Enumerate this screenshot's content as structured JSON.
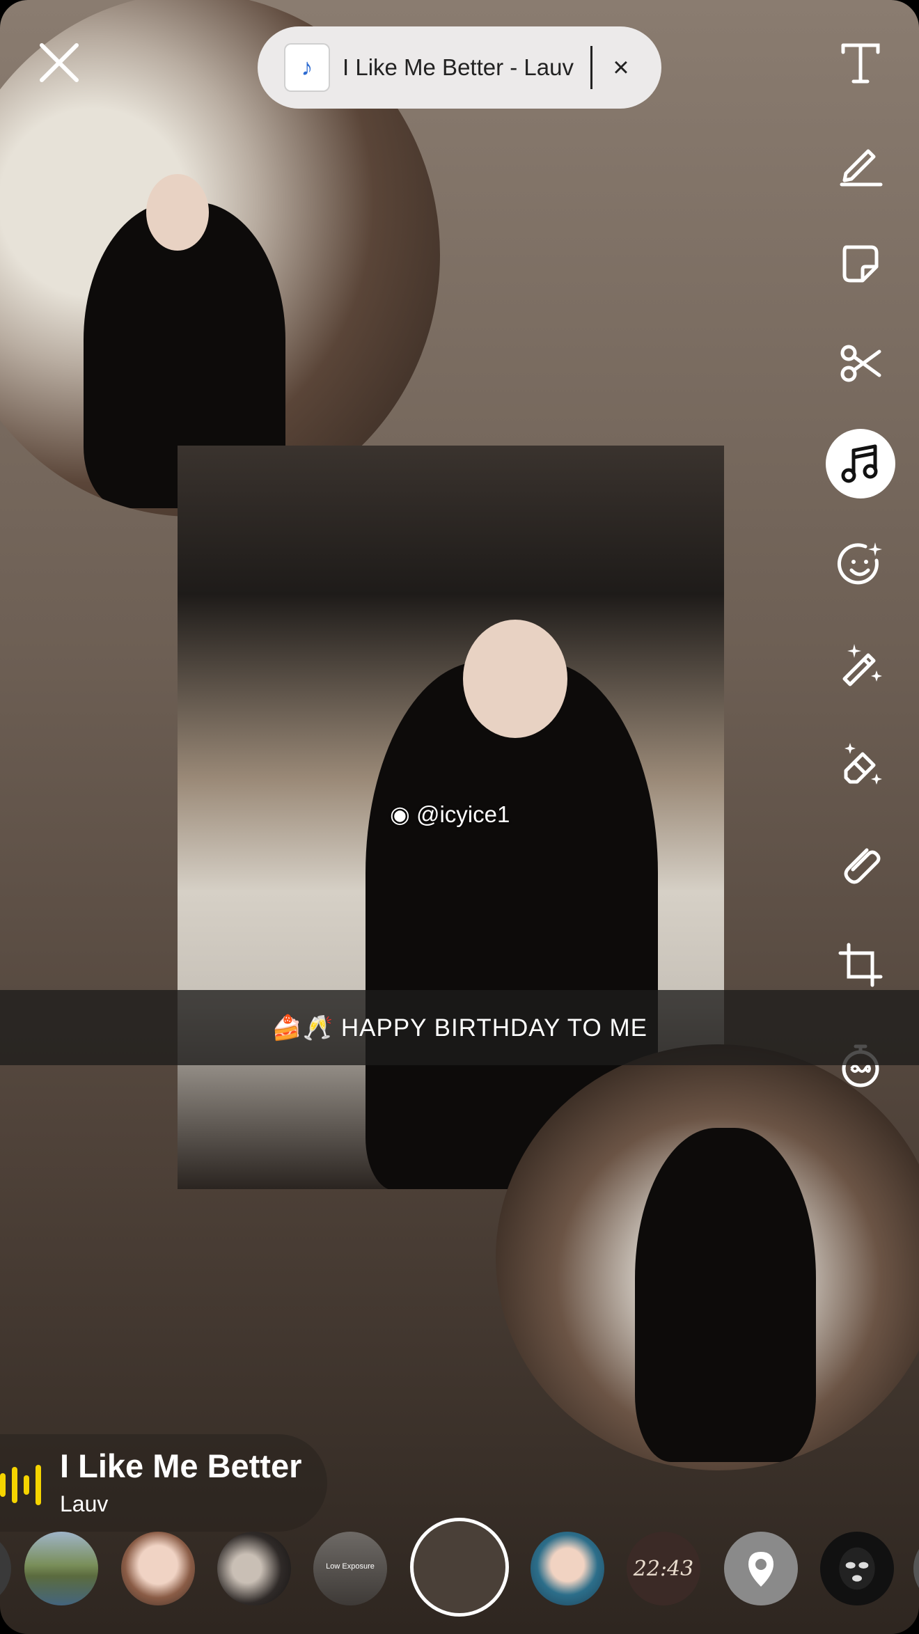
{
  "music_pill": {
    "title": "I Like Me Better - Lauv",
    "close": "×"
  },
  "toolbar": {
    "items": [
      {
        "name": "text-tool",
        "icon": "text-icon"
      },
      {
        "name": "draw-tool",
        "icon": "pencil-icon"
      },
      {
        "name": "sticker-tool",
        "icon": "sticker-icon"
      },
      {
        "name": "scissors-tool",
        "icon": "scissors-icon"
      },
      {
        "name": "music-tool",
        "icon": "music-note-icon",
        "active": true
      },
      {
        "name": "lens-tool",
        "icon": "smiley-icon"
      },
      {
        "name": "magic-wand-tool",
        "icon": "magic-wand-icon"
      },
      {
        "name": "magic-eraser-tool",
        "icon": "magic-eraser-icon"
      },
      {
        "name": "link-tool",
        "icon": "paperclip-icon"
      },
      {
        "name": "crop-tool",
        "icon": "crop-icon"
      },
      {
        "name": "timer-tool",
        "icon": "timer-icon"
      }
    ]
  },
  "caption": {
    "text": "🍰🥂 HAPPY BIRTHDAY TO ME"
  },
  "watermark": {
    "text": "@icyice1",
    "icon": "weibo-icon"
  },
  "now_playing": {
    "title": "I Like Me Better",
    "artist": "Lauv"
  },
  "carousel": {
    "low_exposure_label": "Low Exposure",
    "time_label": "22:43"
  },
  "colors": {
    "accent_yellow": "#f5d400",
    "pill_bg": "#eceaea"
  }
}
